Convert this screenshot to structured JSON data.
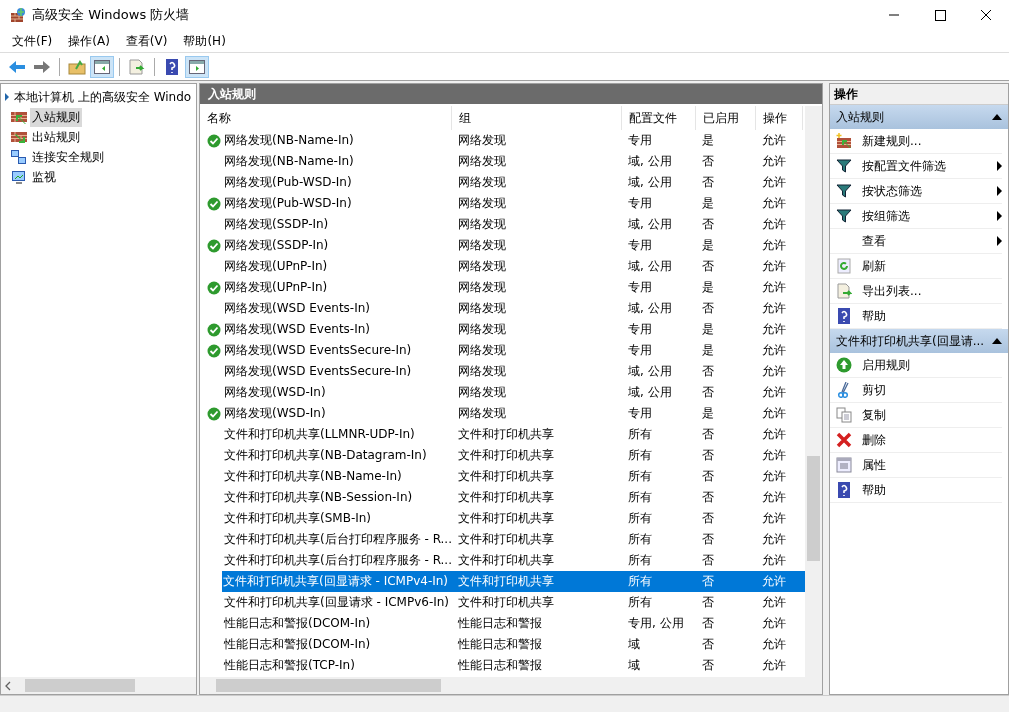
{
  "window": {
    "title": "高级安全 Windows 防火墙"
  },
  "menu": [
    "文件(F)",
    "操作(A)",
    "查看(V)",
    "帮助(H)"
  ],
  "sidebar": {
    "items": [
      {
        "label": "本地计算机 上的高级安全 Windo",
        "selected": false,
        "expanded": true,
        "children": [
          {
            "label": "入站规则",
            "kind": "inbound",
            "selected": true
          },
          {
            "label": "出站规则",
            "kind": "outbound",
            "selected": false
          },
          {
            "label": "连接安全规则",
            "kind": "connection",
            "selected": false
          },
          {
            "label": "监视",
            "kind": "monitor",
            "selected": false
          }
        ]
      }
    ]
  },
  "panel_title": "入站规则",
  "table": {
    "columns": [
      "名称",
      "组",
      "配置文件",
      "已启用",
      "操作"
    ],
    "rows": [
      {
        "name": "网络发现(NB-Name-In)",
        "group": "网络发现",
        "profile": "专用",
        "enabled_text": "是",
        "action": "允许",
        "enabled": true,
        "selected": false
      },
      {
        "name": "网络发现(NB-Name-In)",
        "group": "网络发现",
        "profile": "域, 公用",
        "enabled_text": "否",
        "action": "允许",
        "enabled": false,
        "selected": false
      },
      {
        "name": "网络发现(Pub-WSD-In)",
        "group": "网络发现",
        "profile": "域, 公用",
        "enabled_text": "否",
        "action": "允许",
        "enabled": false,
        "selected": false
      },
      {
        "name": "网络发现(Pub-WSD-In)",
        "group": "网络发现",
        "profile": "专用",
        "enabled_text": "是",
        "action": "允许",
        "enabled": true,
        "selected": false
      },
      {
        "name": "网络发现(SSDP-In)",
        "group": "网络发现",
        "profile": "域, 公用",
        "enabled_text": "否",
        "action": "允许",
        "enabled": false,
        "selected": false
      },
      {
        "name": "网络发现(SSDP-In)",
        "group": "网络发现",
        "profile": "专用",
        "enabled_text": "是",
        "action": "允许",
        "enabled": true,
        "selected": false
      },
      {
        "name": "网络发现(UPnP-In)",
        "group": "网络发现",
        "profile": "域, 公用",
        "enabled_text": "否",
        "action": "允许",
        "enabled": false,
        "selected": false
      },
      {
        "name": "网络发现(UPnP-In)",
        "group": "网络发现",
        "profile": "专用",
        "enabled_text": "是",
        "action": "允许",
        "enabled": true,
        "selected": false
      },
      {
        "name": "网络发现(WSD Events-In)",
        "group": "网络发现",
        "profile": "域, 公用",
        "enabled_text": "否",
        "action": "允许",
        "enabled": false,
        "selected": false
      },
      {
        "name": "网络发现(WSD Events-In)",
        "group": "网络发现",
        "profile": "专用",
        "enabled_text": "是",
        "action": "允许",
        "enabled": true,
        "selected": false
      },
      {
        "name": "网络发现(WSD EventsSecure-In)",
        "group": "网络发现",
        "profile": "专用",
        "enabled_text": "是",
        "action": "允许",
        "enabled": true,
        "selected": false
      },
      {
        "name": "网络发现(WSD EventsSecure-In)",
        "group": "网络发现",
        "profile": "域, 公用",
        "enabled_text": "否",
        "action": "允许",
        "enabled": false,
        "selected": false
      },
      {
        "name": "网络发现(WSD-In)",
        "group": "网络发现",
        "profile": "域, 公用",
        "enabled_text": "否",
        "action": "允许",
        "enabled": false,
        "selected": false
      },
      {
        "name": "网络发现(WSD-In)",
        "group": "网络发现",
        "profile": "专用",
        "enabled_text": "是",
        "action": "允许",
        "enabled": true,
        "selected": false
      },
      {
        "name": "文件和打印机共享(LLMNR-UDP-In)",
        "group": "文件和打印机共享",
        "profile": "所有",
        "enabled_text": "否",
        "action": "允许",
        "enabled": false,
        "selected": false
      },
      {
        "name": "文件和打印机共享(NB-Datagram-In)",
        "group": "文件和打印机共享",
        "profile": "所有",
        "enabled_text": "否",
        "action": "允许",
        "enabled": false,
        "selected": false
      },
      {
        "name": "文件和打印机共享(NB-Name-In)",
        "group": "文件和打印机共享",
        "profile": "所有",
        "enabled_text": "否",
        "action": "允许",
        "enabled": false,
        "selected": false
      },
      {
        "name": "文件和打印机共享(NB-Session-In)",
        "group": "文件和打印机共享",
        "profile": "所有",
        "enabled_text": "否",
        "action": "允许",
        "enabled": false,
        "selected": false
      },
      {
        "name": "文件和打印机共享(SMB-In)",
        "group": "文件和打印机共享",
        "profile": "所有",
        "enabled_text": "否",
        "action": "允许",
        "enabled": false,
        "selected": false
      },
      {
        "name": "文件和打印机共享(后台打印程序服务 - R...",
        "group": "文件和打印机共享",
        "profile": "所有",
        "enabled_text": "否",
        "action": "允许",
        "enabled": false,
        "selected": false
      },
      {
        "name": "文件和打印机共享(后台打印程序服务 - R...",
        "group": "文件和打印机共享",
        "profile": "所有",
        "enabled_text": "否",
        "action": "允许",
        "enabled": false,
        "selected": false
      },
      {
        "name": "文件和打印机共享(回显请求 - ICMPv4-In)",
        "group": "文件和打印机共享",
        "profile": "所有",
        "enabled_text": "否",
        "action": "允许",
        "enabled": false,
        "selected": true
      },
      {
        "name": "文件和打印机共享(回显请求 - ICMPv6-In)",
        "group": "文件和打印机共享",
        "profile": "所有",
        "enabled_text": "否",
        "action": "允许",
        "enabled": false,
        "selected": false
      },
      {
        "name": "性能日志和警报(DCOM-In)",
        "group": "性能日志和警报",
        "profile": "专用, 公用",
        "enabled_text": "否",
        "action": "允许",
        "enabled": false,
        "selected": false
      },
      {
        "name": "性能日志和警报(DCOM-In)",
        "group": "性能日志和警报",
        "profile": "域",
        "enabled_text": "否",
        "action": "允许",
        "enabled": false,
        "selected": false
      },
      {
        "name": "性能日志和警报(TCP-In)",
        "group": "性能日志和警报",
        "profile": "域",
        "enabled_text": "否",
        "action": "允许",
        "enabled": false,
        "selected": false
      }
    ]
  },
  "actions": {
    "title": "操作",
    "sections": [
      {
        "title": "入站规则",
        "expanded": true,
        "items": [
          {
            "label": "新建规则...",
            "kind": "new",
            "submenu": false
          },
          {
            "label": "按配置文件筛选",
            "kind": "filter",
            "submenu": true
          },
          {
            "label": "按状态筛选",
            "kind": "filter",
            "submenu": true
          },
          {
            "label": "按组筛选",
            "kind": "filter",
            "submenu": true
          },
          {
            "label": "查看",
            "kind": "none",
            "submenu": true
          },
          {
            "label": "刷新",
            "kind": "refresh",
            "submenu": false
          },
          {
            "label": "导出列表...",
            "kind": "export",
            "submenu": false
          },
          {
            "label": "帮助",
            "kind": "help",
            "submenu": false
          }
        ]
      },
      {
        "title": "文件和打印机共享(回显请...",
        "expanded": true,
        "items": [
          {
            "label": "启用规则",
            "kind": "enable",
            "submenu": false
          },
          {
            "label": "剪切",
            "kind": "cut",
            "submenu": false
          },
          {
            "label": "复制",
            "kind": "copy",
            "submenu": false
          },
          {
            "label": "删除",
            "kind": "delete",
            "submenu": false
          },
          {
            "label": "属性",
            "kind": "properties",
            "submenu": false
          },
          {
            "label": "帮助",
            "kind": "help",
            "submenu": false
          }
        ]
      }
    ]
  }
}
